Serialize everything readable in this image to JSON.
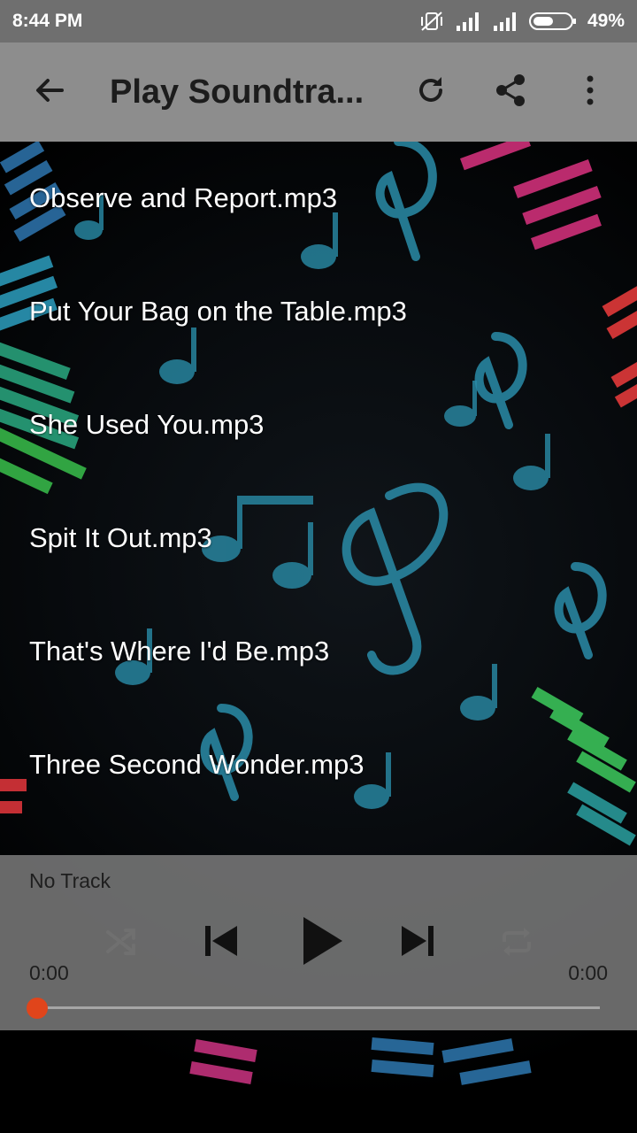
{
  "status_bar": {
    "time": "8:44 PM",
    "battery": "49%",
    "icons": [
      "vibrate-off-icon",
      "signal-icon",
      "signal-icon",
      "battery-icon"
    ]
  },
  "app_bar": {
    "title": "Play Soundtra...",
    "icons": [
      "back-arrow-icon",
      "refresh-icon",
      "share-icon",
      "more-vert-icon"
    ]
  },
  "tracks": [
    {
      "label": "Observe and Report.mp3"
    },
    {
      "label": "Put Your Bag on the Table.mp3"
    },
    {
      "label": "She Used You.mp3"
    },
    {
      "label": "Spit It Out.mp3"
    },
    {
      "label": "That's Where I'd Be.mp3"
    },
    {
      "label": "Three Second Wonder.mp3"
    }
  ],
  "player": {
    "now_playing": "No Track",
    "elapsed": "0:00",
    "duration": "0:00",
    "progress": 0,
    "icons": [
      "shuffle-icon",
      "skip-previous-icon",
      "play-icon",
      "skip-next-icon",
      "repeat-icon"
    ]
  },
  "colors": {
    "status_bar": "#6f6f6f",
    "app_bar": "#8d8d8d",
    "seek_thumb": "#e0451b",
    "note_accent": "#2a8ca8"
  }
}
